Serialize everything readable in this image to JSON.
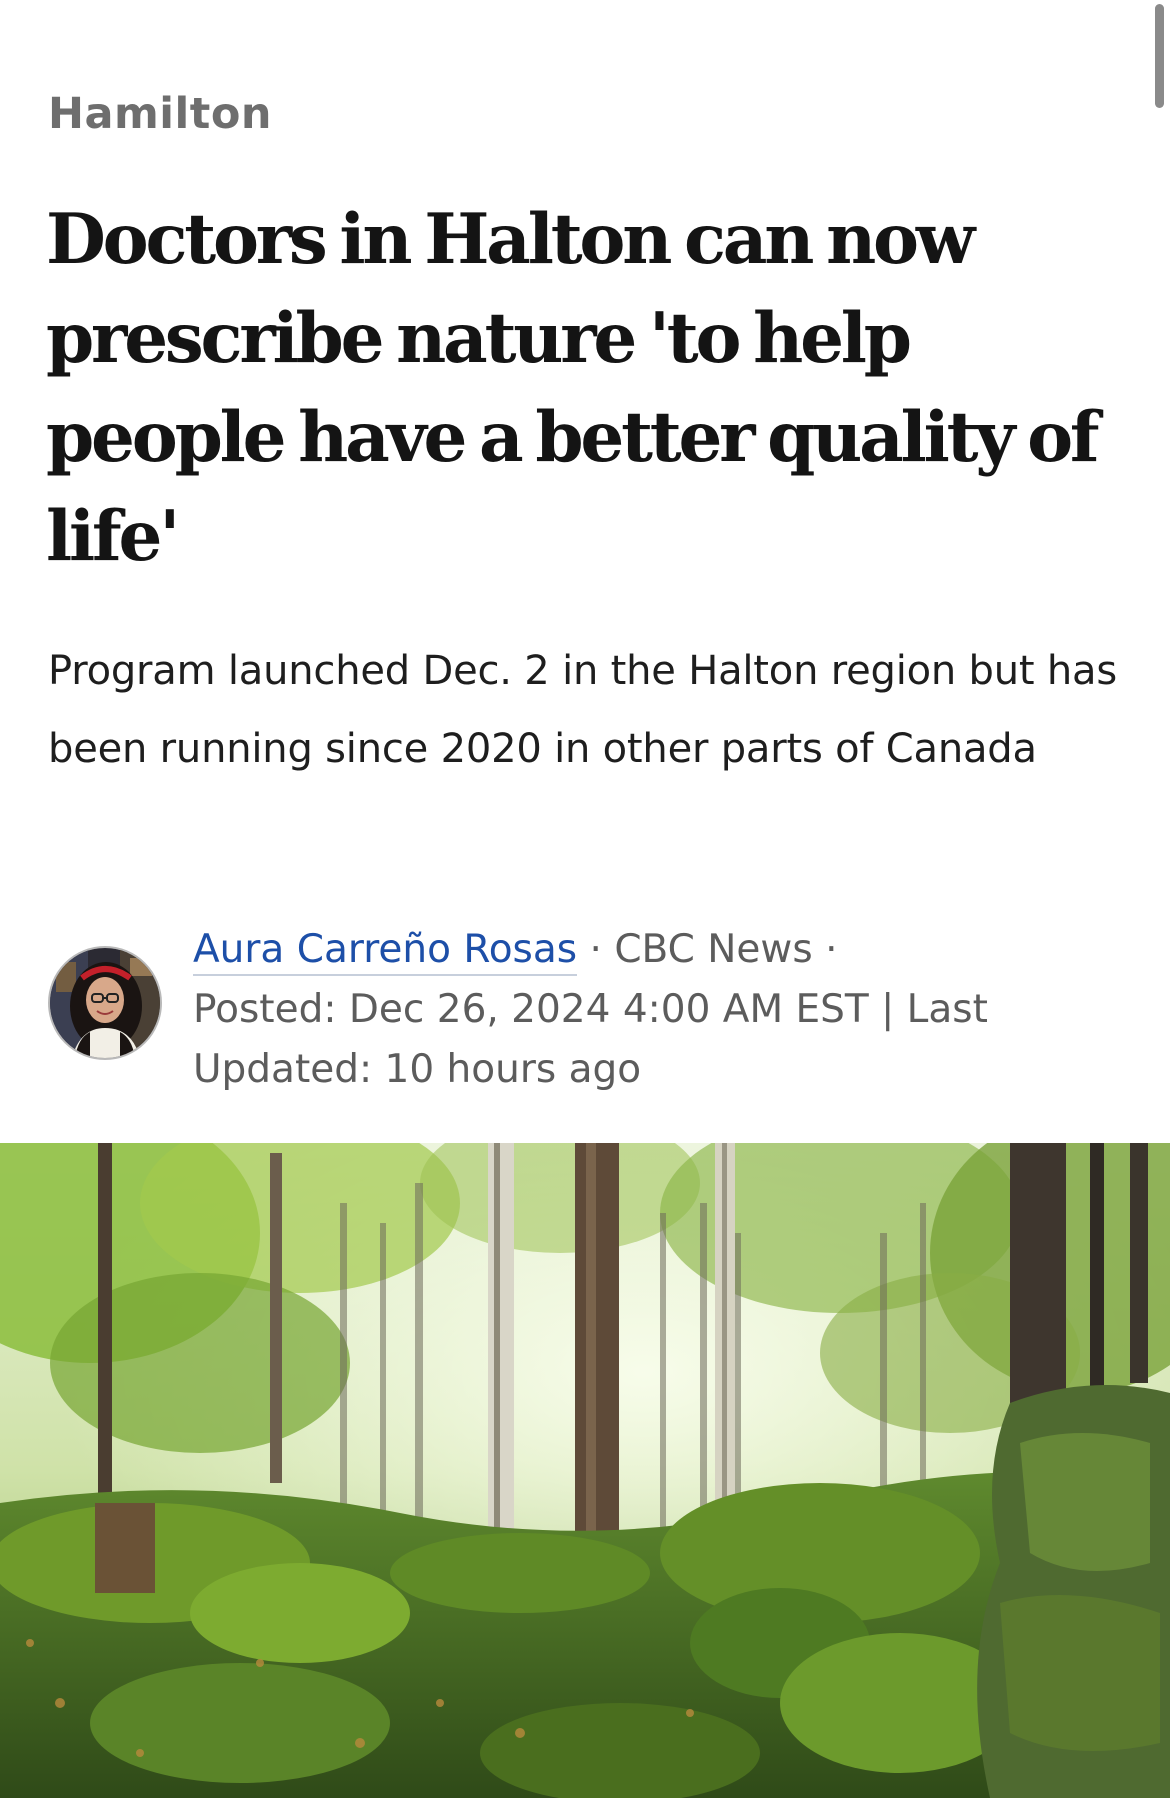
{
  "article": {
    "section": "Hamilton",
    "headline": "Doctors in Halton can now prescribe nature 'to help people have a better quality of life'",
    "deck": "Program launched Dec. 2 in the Halton region but has been running since 2020 in other parts of Canada",
    "byline": {
      "author": "Aura Carreño Rosas",
      "separator": "·",
      "outlet": "CBC News",
      "posted": "Posted: Dec 26, 2024 4:00 AM EST | Last Updated: 10 hours ago"
    }
  },
  "icons": {
    "avatar": "author-avatar-photo",
    "hero": "forest-photo"
  },
  "colors": {
    "section_label": "#6e6e6e",
    "author_link": "#1d4fa8",
    "meta_text": "#5c5c5c",
    "headline": "#141414"
  }
}
